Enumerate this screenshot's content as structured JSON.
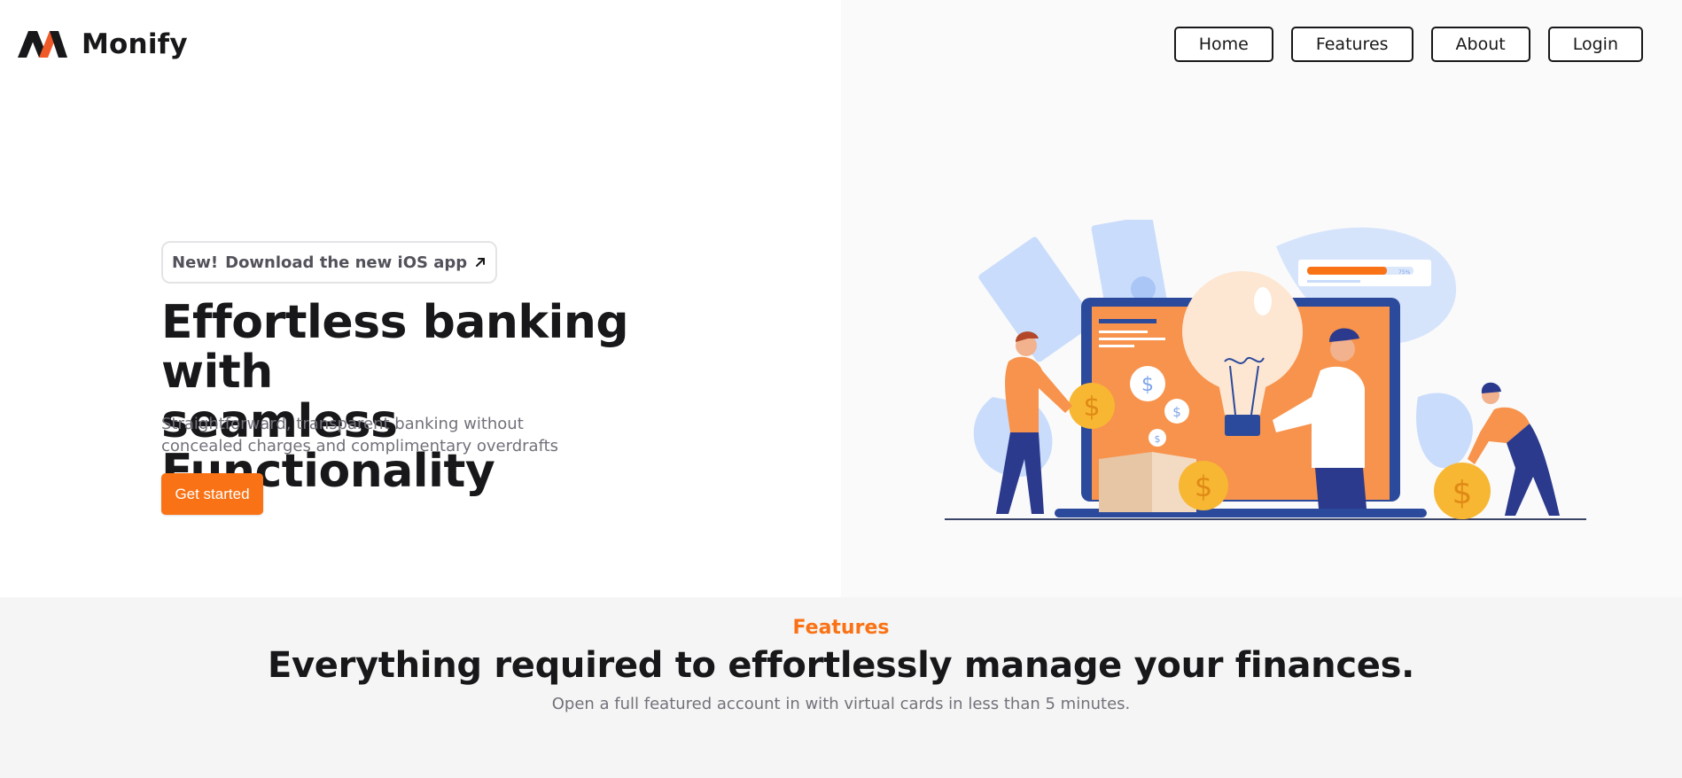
{
  "brand": {
    "name": "Monify",
    "accent_color": "#f97316",
    "logo_icon": "monify-logo-icon"
  },
  "nav": {
    "items": [
      "Home",
      "Features",
      "About",
      "Login"
    ]
  },
  "hero": {
    "badge_new": "New!",
    "badge_text": "Download the new iOS app",
    "badge_icon": "arrow-up-right-icon",
    "title_line1": "Effortless banking with",
    "title_line2": "seamless Functionality",
    "subtitle": "Straightforward, transparent banking without concealed charges and complimentary overdrafts",
    "cta_label": "Get started",
    "illustration_progress_label": "75%",
    "illustration_progress": 0.75
  },
  "features": {
    "label": "Features",
    "title": "Everything required to effortlessly manage your finances.",
    "subtitle": "Open a full featured account in with virtual cards in less than 5 minutes."
  }
}
